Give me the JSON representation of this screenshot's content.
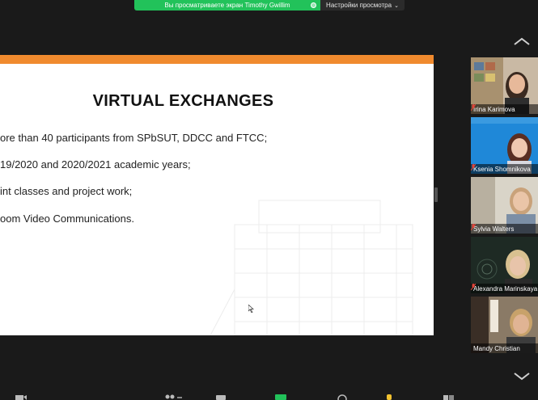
{
  "share_banner": {
    "viewing_text": "Вы просматриваете экран Timothy Gwillim",
    "view_options_label": "Настройки просмотра",
    "accent_color": "#22c25a"
  },
  "slide": {
    "title": "VIRTUAL EXCHANGES",
    "bullets": [
      "ore than 40 participants from SPbSUT, DDCC and FTCC;",
      "19/2020 and 2020/2021 academic years;",
      "int classes and project work;",
      "oom Video Communications."
    ],
    "band_color": "#f08a2e"
  },
  "participants": [
    {
      "name": "Irina Karimova",
      "muted": true
    },
    {
      "name": "Ksenia Shomnikova",
      "muted": true
    },
    {
      "name": "Sylvia Walters",
      "muted": true
    },
    {
      "name": "Alexandra Marinskaya",
      "muted": true
    },
    {
      "name": "Mandy Christian",
      "muted": false,
      "active_speaker": true
    }
  ],
  "icons": {
    "gallery_up": "chevron-up-icon",
    "gallery_down": "chevron-down-icon",
    "mic_muted": "mic-muted-icon",
    "view_options": "chevron-down-icon"
  }
}
